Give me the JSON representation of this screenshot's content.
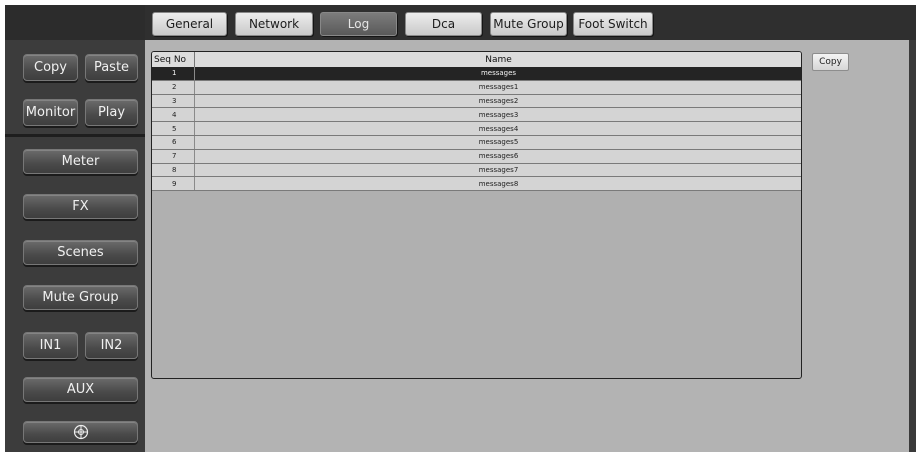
{
  "sidebar": {
    "copy_label": "Copy",
    "paste_label": "Paste",
    "monitor_label": "Monitor",
    "play_label": "Play",
    "meter_label": "Meter",
    "fx_label": "FX",
    "scenes_label": "Scenes",
    "mute_group_label": "Mute Group",
    "in1_label": "IN1",
    "in2_label": "IN2",
    "aux_label": "AUX",
    "bottom_icon": "crosshair-circle-icon"
  },
  "tabs": [
    {
      "label": "General"
    },
    {
      "label": "Network"
    },
    {
      "label": "Log"
    },
    {
      "label": "Dca"
    },
    {
      "label": "Mute Group"
    },
    {
      "label": "Foot Switch"
    }
  ],
  "active_tab": "Log",
  "log_table": {
    "columns": {
      "seq": "Seq No",
      "name": "Name"
    },
    "rows": [
      {
        "seq": "1",
        "name": "messages"
      },
      {
        "seq": "2",
        "name": "messages1"
      },
      {
        "seq": "3",
        "name": "messages2"
      },
      {
        "seq": "4",
        "name": "messages3"
      },
      {
        "seq": "5",
        "name": "messages4"
      },
      {
        "seq": "6",
        "name": "messages5"
      },
      {
        "seq": "7",
        "name": "messages6"
      },
      {
        "seq": "8",
        "name": "messages7"
      },
      {
        "seq": "9",
        "name": "messages8"
      }
    ],
    "selected_row": "1"
  },
  "copy_button_label": "Copy",
  "colors": {
    "panel_bg": "#b3b3b3",
    "sidebar_bg": "#3c3c3c",
    "selected_row": "#242424"
  }
}
